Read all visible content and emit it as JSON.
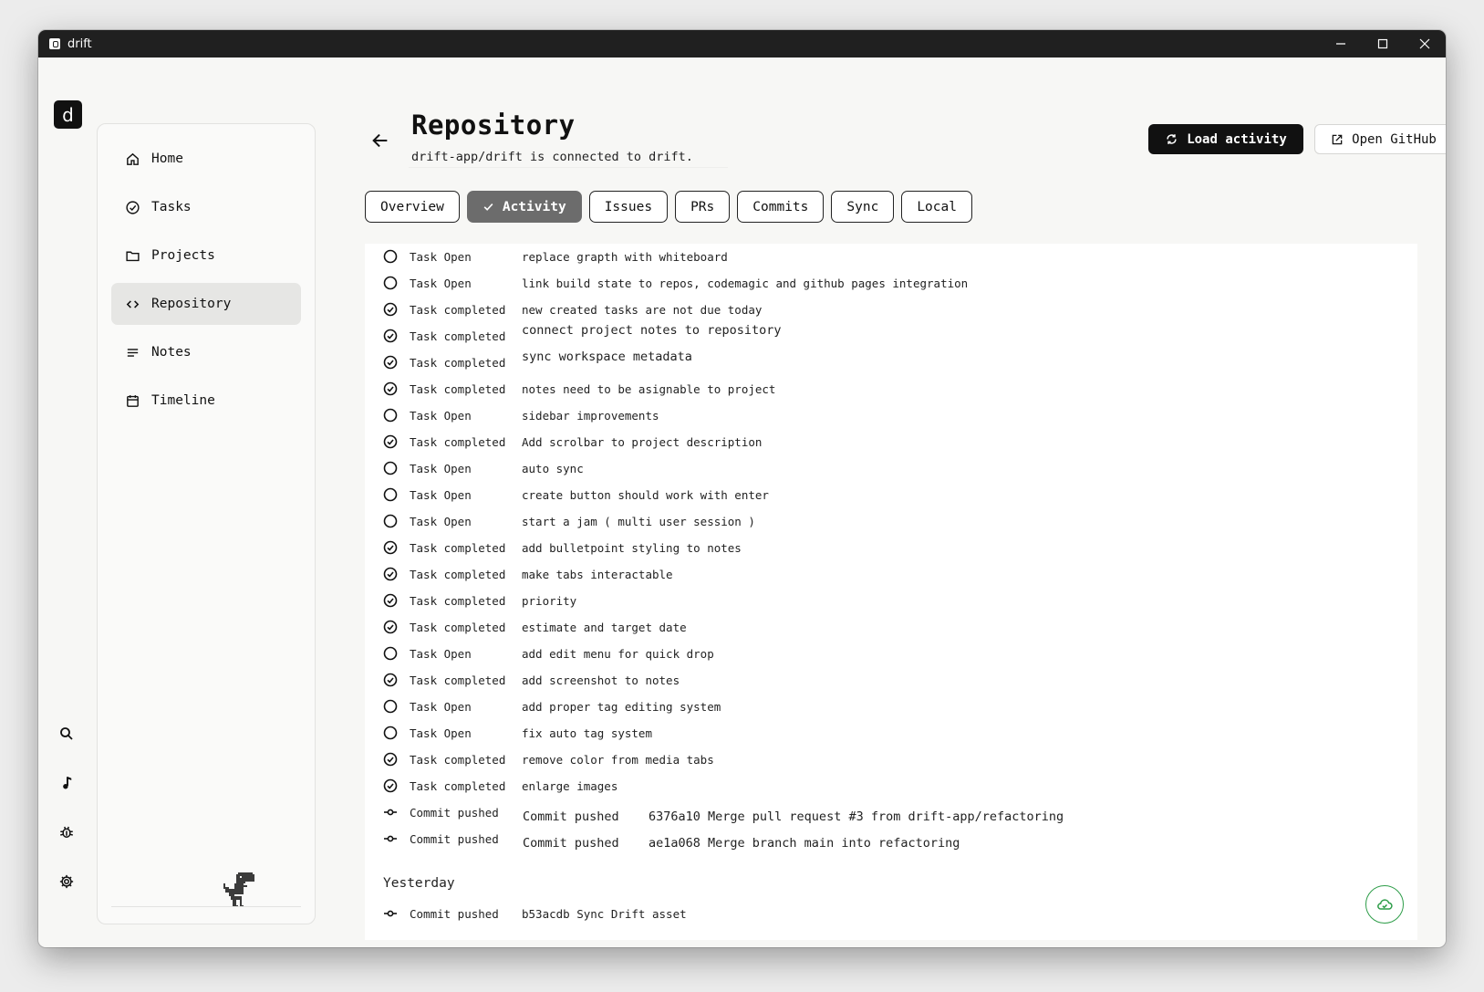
{
  "window": {
    "title": "drift"
  },
  "rail": {
    "logo_text": "d",
    "icons": [
      "search-icon",
      "music-note-icon",
      "bug-icon",
      "gear-icon"
    ]
  },
  "sidebar": {
    "items": [
      {
        "label": "Home",
        "icon": "home-icon"
      },
      {
        "label": "Tasks",
        "icon": "check-circle-icon"
      },
      {
        "label": "Projects",
        "icon": "folder-icon"
      },
      {
        "label": "Repository",
        "icon": "code-icon",
        "active": true
      },
      {
        "label": "Notes",
        "icon": "lines-icon"
      },
      {
        "label": "Timeline",
        "icon": "calendar-icon"
      }
    ]
  },
  "header": {
    "title": "Repository",
    "subtitle": "drift-app/drift is connected to drift.",
    "load_label": "Load activity",
    "github_label": "Open GitHub"
  },
  "tabs": [
    {
      "label": "Overview"
    },
    {
      "label": "Activity",
      "active": true
    },
    {
      "label": "Issues"
    },
    {
      "label": "PRs"
    },
    {
      "label": "Commits"
    },
    {
      "label": "Sync"
    },
    {
      "label": "Local"
    }
  ],
  "activity": {
    "rows": [
      {
        "status": "open",
        "kind": "Task Open",
        "title": "replace grapth with whiteboard"
      },
      {
        "status": "open",
        "kind": "Task Open",
        "title": "link build state to repos, codemagic and github pages integration"
      },
      {
        "status": "done",
        "kind": "Task completed",
        "title": "new created tasks are not due today"
      },
      {
        "status": "done",
        "kind": "Task completed",
        "title": "connect project notes to repository"
      },
      {
        "status": "done",
        "kind": "Task completed",
        "title": "sync workspace metadata"
      },
      {
        "status": "done",
        "kind": "Task completed",
        "title": "notes need to be asignable to project"
      },
      {
        "status": "open",
        "kind": "Task Open",
        "title": "sidebar improvements"
      },
      {
        "status": "done",
        "kind": "Task completed",
        "title": "Add scrolbar to project description"
      },
      {
        "status": "open",
        "kind": "Task Open",
        "title": "auto sync"
      },
      {
        "status": "open",
        "kind": "Task Open",
        "title": "create button should work with enter"
      },
      {
        "status": "open",
        "kind": "Task Open",
        "title": "start a jam ( multi user session )"
      },
      {
        "status": "done",
        "kind": "Task completed",
        "title": "add bulletpoint styling to notes"
      },
      {
        "status": "done",
        "kind": "Task completed",
        "title": "make tabs interactable"
      },
      {
        "status": "done",
        "kind": "Task completed",
        "title": "priority"
      },
      {
        "status": "done",
        "kind": "Task completed",
        "title": "estimate and target date"
      },
      {
        "status": "open",
        "kind": "Task Open",
        "title": "add edit menu for quick drop"
      },
      {
        "status": "done",
        "kind": "Task completed",
        "title": "add screenshot to notes"
      },
      {
        "status": "open",
        "kind": "Task Open",
        "title": "add proper tag editing system"
      },
      {
        "status": "open",
        "kind": "Task Open",
        "title": "fix auto tag system"
      },
      {
        "status": "done",
        "kind": "Task completed",
        "title": "remove color from media tabs"
      },
      {
        "status": "done",
        "kind": "Task completed",
        "title": "enlarge images"
      }
    ],
    "commits": [
      {
        "kind": "Commit pushed",
        "label": "Commit pushed",
        "message": "6376a10 Merge pull request #3 from drift-app/refactoring"
      },
      {
        "kind": "Commit pushed",
        "label": "Commit pushed",
        "message": "ae1a068 Merge branch main into refactoring"
      }
    ],
    "yesterday_heading": "Yesterday",
    "yesterday": [
      {
        "kind": "Commit pushed",
        "title": "b53acdb Sync Drift asset"
      }
    ]
  },
  "colors": {
    "accent_dark": "#111111",
    "active_tab": "#6c6c6c",
    "sync_green": "#2e9d49"
  }
}
